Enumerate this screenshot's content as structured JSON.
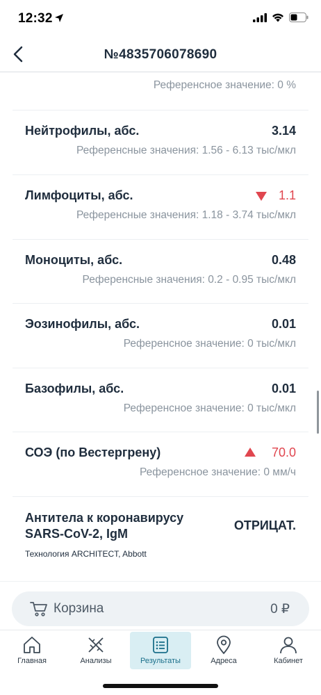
{
  "status_bar": {
    "time": "12:32"
  },
  "header": {
    "title": "№4835706078690"
  },
  "results": [
    {
      "name": "",
      "value": "",
      "reference": "Референсное значение: 0 %"
    },
    {
      "name": "Нейтрофилы, абс.",
      "value": "3.14",
      "reference": "Референсные значения: 1.56 - 6.13 тыс/мкл"
    },
    {
      "name": "Лимфоциты, абс.",
      "value": "1.1",
      "flag": "low",
      "reference": "Референсные значения: 1.18 - 3.74 тыс/мкл"
    },
    {
      "name": "Моноциты, абс.",
      "value": "0.48",
      "reference": "Референсные значения: 0.2 - 0.95 тыс/мкл"
    },
    {
      "name": "Эозинофилы, абс.",
      "value": "0.01",
      "reference": "Референсное значение: 0 тыс/мкл"
    },
    {
      "name": "Базофилы, абс.",
      "value": "0.01",
      "reference": "Референсное значение: 0 тыс/мкл"
    },
    {
      "name": "СОЭ (по Вестергрену)",
      "value": "70.0",
      "flag": "high",
      "reference": "Референсное значение: 0 мм/ч"
    },
    {
      "name_line1": "Антитела к коронавирусу",
      "name_line2": "SARS-CoV-2, IgM",
      "value": "ОТРИЦАТ.",
      "note": "Технология ARCHITECT, Abbott"
    }
  ],
  "cart": {
    "label": "Корзина",
    "total": "0 ₽"
  },
  "tabs": [
    {
      "label": "Главная",
      "icon": "home-icon"
    },
    {
      "label": "Анализы",
      "icon": "dna-icon"
    },
    {
      "label": "Результаты",
      "icon": "list-icon",
      "active": true
    },
    {
      "label": "Адреса",
      "icon": "location-pin-icon"
    },
    {
      "label": "Кабинет",
      "icon": "user-icon"
    }
  ],
  "colors": {
    "accent": "#1a6f8a",
    "flag": "#e0464f",
    "active_tab_bg": "#d9eef3"
  }
}
